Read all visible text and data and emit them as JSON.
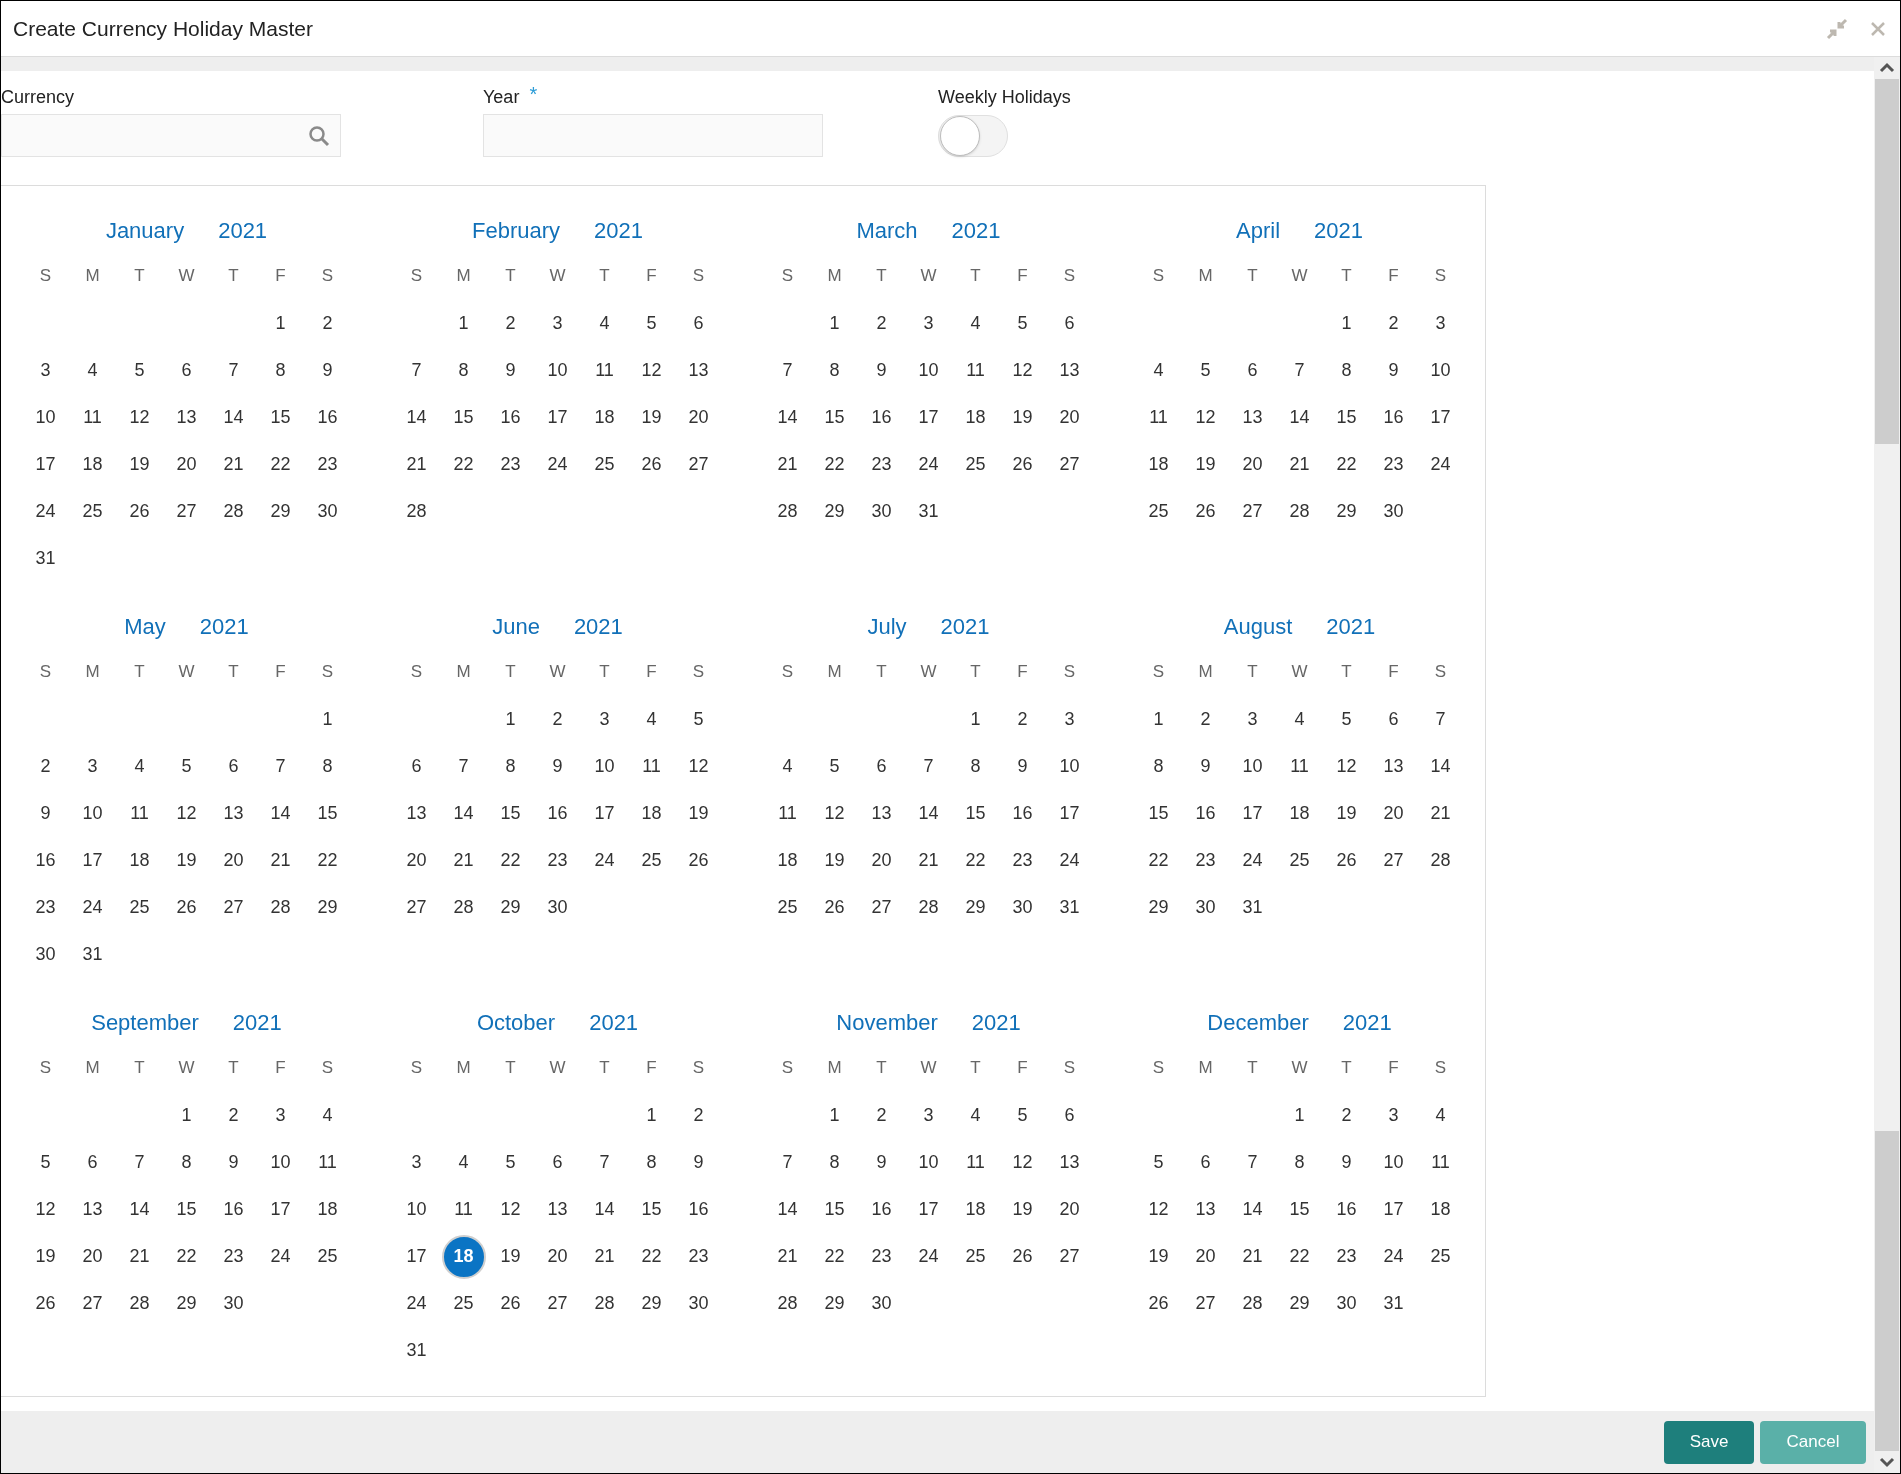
{
  "window": {
    "title": "Create Currency Holiday Master"
  },
  "form": {
    "currency": {
      "label": "Currency"
    },
    "year": {
      "label": "Year",
      "required_mark": "*"
    },
    "weekly_holidays": {
      "label": "Weekly Holidays",
      "on": false
    }
  },
  "months": [
    {
      "name": "January",
      "year": "2021",
      "weekdays": [
        "S",
        "M",
        "T",
        "W",
        "T",
        "F",
        "S"
      ],
      "weeks": [
        {
          "kind": "end",
          "days": [
            {
              "day": "1",
              "selected": false
            },
            {
              "day": "2",
              "selected": false
            }
          ]
        },
        {
          "kind": "start",
          "days": [
            {
              "day": "3",
              "selected": false
            },
            {
              "day": "4",
              "selected": false
            },
            {
              "day": "5",
              "selected": false
            },
            {
              "day": "6",
              "selected": false
            },
            {
              "day": "7",
              "selected": false
            },
            {
              "day": "8",
              "selected": false
            },
            {
              "day": "9",
              "selected": false
            }
          ]
        },
        {
          "kind": "start",
          "days": [
            {
              "day": "10",
              "selected": false
            },
            {
              "day": "11",
              "selected": false
            },
            {
              "day": "12",
              "selected": false
            },
            {
              "day": "13",
              "selected": false
            },
            {
              "day": "14",
              "selected": false
            },
            {
              "day": "15",
              "selected": false
            },
            {
              "day": "16",
              "selected": false
            }
          ]
        },
        {
          "kind": "start",
          "days": [
            {
              "day": "17",
              "selected": false
            },
            {
              "day": "18",
              "selected": false
            },
            {
              "day": "19",
              "selected": false
            },
            {
              "day": "20",
              "selected": false
            },
            {
              "day": "21",
              "selected": false
            },
            {
              "day": "22",
              "selected": false
            },
            {
              "day": "23",
              "selected": false
            }
          ]
        },
        {
          "kind": "start",
          "days": [
            {
              "day": "24",
              "selected": false
            },
            {
              "day": "25",
              "selected": false
            },
            {
              "day": "26",
              "selected": false
            },
            {
              "day": "27",
              "selected": false
            },
            {
              "day": "28",
              "selected": false
            },
            {
              "day": "29",
              "selected": false
            },
            {
              "day": "30",
              "selected": false
            }
          ]
        },
        {
          "kind": "start",
          "days": [
            {
              "day": "31",
              "selected": false
            }
          ]
        }
      ]
    },
    {
      "name": "February",
      "year": "2021",
      "weekdays": [
        "S",
        "M",
        "T",
        "W",
        "T",
        "F",
        "S"
      ],
      "weeks": [
        {
          "kind": "end",
          "days": [
            {
              "day": "1",
              "selected": false
            },
            {
              "day": "2",
              "selected": false
            },
            {
              "day": "3",
              "selected": false
            },
            {
              "day": "4",
              "selected": false
            },
            {
              "day": "5",
              "selected": false
            },
            {
              "day": "6",
              "selected": false
            }
          ]
        },
        {
          "kind": "start",
          "days": [
            {
              "day": "7",
              "selected": false
            },
            {
              "day": "8",
              "selected": false
            },
            {
              "day": "9",
              "selected": false
            },
            {
              "day": "10",
              "selected": false
            },
            {
              "day": "11",
              "selected": false
            },
            {
              "day": "12",
              "selected": false
            },
            {
              "day": "13",
              "selected": false
            }
          ]
        },
        {
          "kind": "start",
          "days": [
            {
              "day": "14",
              "selected": false
            },
            {
              "day": "15",
              "selected": false
            },
            {
              "day": "16",
              "selected": false
            },
            {
              "day": "17",
              "selected": false
            },
            {
              "day": "18",
              "selected": false
            },
            {
              "day": "19",
              "selected": false
            },
            {
              "day": "20",
              "selected": false
            }
          ]
        },
        {
          "kind": "start",
          "days": [
            {
              "day": "21",
              "selected": false
            },
            {
              "day": "22",
              "selected": false
            },
            {
              "day": "23",
              "selected": false
            },
            {
              "day": "24",
              "selected": false
            },
            {
              "day": "25",
              "selected": false
            },
            {
              "day": "26",
              "selected": false
            },
            {
              "day": "27",
              "selected": false
            }
          ]
        },
        {
          "kind": "start",
          "days": [
            {
              "day": "28",
              "selected": false
            }
          ]
        }
      ]
    },
    {
      "name": "March",
      "year": "2021",
      "weekdays": [
        "S",
        "M",
        "T",
        "W",
        "T",
        "F",
        "S"
      ],
      "weeks": [
        {
          "kind": "end",
          "days": [
            {
              "day": "1",
              "selected": false
            },
            {
              "day": "2",
              "selected": false
            },
            {
              "day": "3",
              "selected": false
            },
            {
              "day": "4",
              "selected": false
            },
            {
              "day": "5",
              "selected": false
            },
            {
              "day": "6",
              "selected": false
            }
          ]
        },
        {
          "kind": "start",
          "days": [
            {
              "day": "7",
              "selected": false
            },
            {
              "day": "8",
              "selected": false
            },
            {
              "day": "9",
              "selected": false
            },
            {
              "day": "10",
              "selected": false
            },
            {
              "day": "11",
              "selected": false
            },
            {
              "day": "12",
              "selected": false
            },
            {
              "day": "13",
              "selected": false
            }
          ]
        },
        {
          "kind": "start",
          "days": [
            {
              "day": "14",
              "selected": false
            },
            {
              "day": "15",
              "selected": false
            },
            {
              "day": "16",
              "selected": false
            },
            {
              "day": "17",
              "selected": false
            },
            {
              "day": "18",
              "selected": false
            },
            {
              "day": "19",
              "selected": false
            },
            {
              "day": "20",
              "selected": false
            }
          ]
        },
        {
          "kind": "start",
          "days": [
            {
              "day": "21",
              "selected": false
            },
            {
              "day": "22",
              "selected": false
            },
            {
              "day": "23",
              "selected": false
            },
            {
              "day": "24",
              "selected": false
            },
            {
              "day": "25",
              "selected": false
            },
            {
              "day": "26",
              "selected": false
            },
            {
              "day": "27",
              "selected": false
            }
          ]
        },
        {
          "kind": "start",
          "days": [
            {
              "day": "28",
              "selected": false
            },
            {
              "day": "29",
              "selected": false
            },
            {
              "day": "30",
              "selected": false
            },
            {
              "day": "31",
              "selected": false
            }
          ]
        }
      ]
    },
    {
      "name": "April",
      "year": "2021",
      "weekdays": [
        "S",
        "M",
        "T",
        "W",
        "T",
        "F",
        "S"
      ],
      "weeks": [
        {
          "kind": "end",
          "days": [
            {
              "day": "1",
              "selected": false
            },
            {
              "day": "2",
              "selected": false
            },
            {
              "day": "3",
              "selected": false
            }
          ]
        },
        {
          "kind": "start",
          "days": [
            {
              "day": "4",
              "selected": false
            },
            {
              "day": "5",
              "selected": false
            },
            {
              "day": "6",
              "selected": false
            },
            {
              "day": "7",
              "selected": false
            },
            {
              "day": "8",
              "selected": false
            },
            {
              "day": "9",
              "selected": false
            },
            {
              "day": "10",
              "selected": false
            }
          ]
        },
        {
          "kind": "start",
          "days": [
            {
              "day": "11",
              "selected": false
            },
            {
              "day": "12",
              "selected": false
            },
            {
              "day": "13",
              "selected": false
            },
            {
              "day": "14",
              "selected": false
            },
            {
              "day": "15",
              "selected": false
            },
            {
              "day": "16",
              "selected": false
            },
            {
              "day": "17",
              "selected": false
            }
          ]
        },
        {
          "kind": "start",
          "days": [
            {
              "day": "18",
              "selected": false
            },
            {
              "day": "19",
              "selected": false
            },
            {
              "day": "20",
              "selected": false
            },
            {
              "day": "21",
              "selected": false
            },
            {
              "day": "22",
              "selected": false
            },
            {
              "day": "23",
              "selected": false
            },
            {
              "day": "24",
              "selected": false
            }
          ]
        },
        {
          "kind": "start",
          "days": [
            {
              "day": "25",
              "selected": false
            },
            {
              "day": "26",
              "selected": false
            },
            {
              "day": "27",
              "selected": false
            },
            {
              "day": "28",
              "selected": false
            },
            {
              "day": "29",
              "selected": false
            },
            {
              "day": "30",
              "selected": false
            }
          ]
        }
      ]
    },
    {
      "name": "May",
      "year": "2021",
      "weekdays": [
        "S",
        "M",
        "T",
        "W",
        "T",
        "F",
        "S"
      ],
      "weeks": [
        {
          "kind": "end",
          "days": [
            {
              "day": "1",
              "selected": false
            }
          ]
        },
        {
          "kind": "start",
          "days": [
            {
              "day": "2",
              "selected": false
            },
            {
              "day": "3",
              "selected": false
            },
            {
              "day": "4",
              "selected": false
            },
            {
              "day": "5",
              "selected": false
            },
            {
              "day": "6",
              "selected": false
            },
            {
              "day": "7",
              "selected": false
            },
            {
              "day": "8",
              "selected": false
            }
          ]
        },
        {
          "kind": "start",
          "days": [
            {
              "day": "9",
              "selected": false
            },
            {
              "day": "10",
              "selected": false
            },
            {
              "day": "11",
              "selected": false
            },
            {
              "day": "12",
              "selected": false
            },
            {
              "day": "13",
              "selected": false
            },
            {
              "day": "14",
              "selected": false
            },
            {
              "day": "15",
              "selected": false
            }
          ]
        },
        {
          "kind": "start",
          "days": [
            {
              "day": "16",
              "selected": false
            },
            {
              "day": "17",
              "selected": false
            },
            {
              "day": "18",
              "selected": false
            },
            {
              "day": "19",
              "selected": false
            },
            {
              "day": "20",
              "selected": false
            },
            {
              "day": "21",
              "selected": false
            },
            {
              "day": "22",
              "selected": false
            }
          ]
        },
        {
          "kind": "start",
          "days": [
            {
              "day": "23",
              "selected": false
            },
            {
              "day": "24",
              "selected": false
            },
            {
              "day": "25",
              "selected": false
            },
            {
              "day": "26",
              "selected": false
            },
            {
              "day": "27",
              "selected": false
            },
            {
              "day": "28",
              "selected": false
            },
            {
              "day": "29",
              "selected": false
            }
          ]
        },
        {
          "kind": "start",
          "days": [
            {
              "day": "30",
              "selected": false
            },
            {
              "day": "31",
              "selected": false
            }
          ]
        }
      ]
    },
    {
      "name": "June",
      "year": "2021",
      "weekdays": [
        "S",
        "M",
        "T",
        "W",
        "T",
        "F",
        "S"
      ],
      "weeks": [
        {
          "kind": "end",
          "days": [
            {
              "day": "1",
              "selected": false
            },
            {
              "day": "2",
              "selected": false
            },
            {
              "day": "3",
              "selected": false
            },
            {
              "day": "4",
              "selected": false
            },
            {
              "day": "5",
              "selected": false
            }
          ]
        },
        {
          "kind": "start",
          "days": [
            {
              "day": "6",
              "selected": false
            },
            {
              "day": "7",
              "selected": false
            },
            {
              "day": "8",
              "selected": false
            },
            {
              "day": "9",
              "selected": false
            },
            {
              "day": "10",
              "selected": false
            },
            {
              "day": "11",
              "selected": false
            },
            {
              "day": "12",
              "selected": false
            }
          ]
        },
        {
          "kind": "start",
          "days": [
            {
              "day": "13",
              "selected": false
            },
            {
              "day": "14",
              "selected": false
            },
            {
              "day": "15",
              "selected": false
            },
            {
              "day": "16",
              "selected": false
            },
            {
              "day": "17",
              "selected": false
            },
            {
              "day": "18",
              "selected": false
            },
            {
              "day": "19",
              "selected": false
            }
          ]
        },
        {
          "kind": "start",
          "days": [
            {
              "day": "20",
              "selected": false
            },
            {
              "day": "21",
              "selected": false
            },
            {
              "day": "22",
              "selected": false
            },
            {
              "day": "23",
              "selected": false
            },
            {
              "day": "24",
              "selected": false
            },
            {
              "day": "25",
              "selected": false
            },
            {
              "day": "26",
              "selected": false
            }
          ]
        },
        {
          "kind": "start",
          "days": [
            {
              "day": "27",
              "selected": false
            },
            {
              "day": "28",
              "selected": false
            },
            {
              "day": "29",
              "selected": false
            },
            {
              "day": "30",
              "selected": false
            }
          ]
        }
      ]
    },
    {
      "name": "July",
      "year": "2021",
      "weekdays": [
        "S",
        "M",
        "T",
        "W",
        "T",
        "F",
        "S"
      ],
      "weeks": [
        {
          "kind": "end",
          "days": [
            {
              "day": "1",
              "selected": false
            },
            {
              "day": "2",
              "selected": false
            },
            {
              "day": "3",
              "selected": false
            }
          ]
        },
        {
          "kind": "start",
          "days": [
            {
              "day": "4",
              "selected": false
            },
            {
              "day": "5",
              "selected": false
            },
            {
              "day": "6",
              "selected": false
            },
            {
              "day": "7",
              "selected": false
            },
            {
              "day": "8",
              "selected": false
            },
            {
              "day": "9",
              "selected": false
            },
            {
              "day": "10",
              "selected": false
            }
          ]
        },
        {
          "kind": "start",
          "days": [
            {
              "day": "11",
              "selected": false
            },
            {
              "day": "12",
              "selected": false
            },
            {
              "day": "13",
              "selected": false
            },
            {
              "day": "14",
              "selected": false
            },
            {
              "day": "15",
              "selected": false
            },
            {
              "day": "16",
              "selected": false
            },
            {
              "day": "17",
              "selected": false
            }
          ]
        },
        {
          "kind": "start",
          "days": [
            {
              "day": "18",
              "selected": false
            },
            {
              "day": "19",
              "selected": false
            },
            {
              "day": "20",
              "selected": false
            },
            {
              "day": "21",
              "selected": false
            },
            {
              "day": "22",
              "selected": false
            },
            {
              "day": "23",
              "selected": false
            },
            {
              "day": "24",
              "selected": false
            }
          ]
        },
        {
          "kind": "start",
          "days": [
            {
              "day": "25",
              "selected": false
            },
            {
              "day": "26",
              "selected": false
            },
            {
              "day": "27",
              "selected": false
            },
            {
              "day": "28",
              "selected": false
            },
            {
              "day": "29",
              "selected": false
            },
            {
              "day": "30",
              "selected": false
            },
            {
              "day": "31",
              "selected": false
            }
          ]
        }
      ]
    },
    {
      "name": "August",
      "year": "2021",
      "weekdays": [
        "S",
        "M",
        "T",
        "W",
        "T",
        "F",
        "S"
      ],
      "weeks": [
        {
          "kind": "start",
          "days": [
            {
              "day": "1",
              "selected": false
            },
            {
              "day": "2",
              "selected": false
            },
            {
              "day": "3",
              "selected": false
            },
            {
              "day": "4",
              "selected": false
            },
            {
              "day": "5",
              "selected": false
            },
            {
              "day": "6",
              "selected": false
            },
            {
              "day": "7",
              "selected": false
            }
          ]
        },
        {
          "kind": "start",
          "days": [
            {
              "day": "8",
              "selected": false
            },
            {
              "day": "9",
              "selected": false
            },
            {
              "day": "10",
              "selected": false
            },
            {
              "day": "11",
              "selected": false
            },
            {
              "day": "12",
              "selected": false
            },
            {
              "day": "13",
              "selected": false
            },
            {
              "day": "14",
              "selected": false
            }
          ]
        },
        {
          "kind": "start",
          "days": [
            {
              "day": "15",
              "selected": false
            },
            {
              "day": "16",
              "selected": false
            },
            {
              "day": "17",
              "selected": false
            },
            {
              "day": "18",
              "selected": false
            },
            {
              "day": "19",
              "selected": false
            },
            {
              "day": "20",
              "selected": false
            },
            {
              "day": "21",
              "selected": false
            }
          ]
        },
        {
          "kind": "start",
          "days": [
            {
              "day": "22",
              "selected": false
            },
            {
              "day": "23",
              "selected": false
            },
            {
              "day": "24",
              "selected": false
            },
            {
              "day": "25",
              "selected": false
            },
            {
              "day": "26",
              "selected": false
            },
            {
              "day": "27",
              "selected": false
            },
            {
              "day": "28",
              "selected": false
            }
          ]
        },
        {
          "kind": "start",
          "days": [
            {
              "day": "29",
              "selected": false
            },
            {
              "day": "30",
              "selected": false
            },
            {
              "day": "31",
              "selected": false
            }
          ]
        }
      ]
    },
    {
      "name": "September",
      "year": "2021",
      "weekdays": [
        "S",
        "M",
        "T",
        "W",
        "T",
        "F",
        "S"
      ],
      "weeks": [
        {
          "kind": "end",
          "days": [
            {
              "day": "1",
              "selected": false
            },
            {
              "day": "2",
              "selected": false
            },
            {
              "day": "3",
              "selected": false
            },
            {
              "day": "4",
              "selected": false
            }
          ]
        },
        {
          "kind": "start",
          "days": [
            {
              "day": "5",
              "selected": false
            },
            {
              "day": "6",
              "selected": false
            },
            {
              "day": "7",
              "selected": false
            },
            {
              "day": "8",
              "selected": false
            },
            {
              "day": "9",
              "selected": false
            },
            {
              "day": "10",
              "selected": false
            },
            {
              "day": "11",
              "selected": false
            }
          ]
        },
        {
          "kind": "start",
          "days": [
            {
              "day": "12",
              "selected": false
            },
            {
              "day": "13",
              "selected": false
            },
            {
              "day": "14",
              "selected": false
            },
            {
              "day": "15",
              "selected": false
            },
            {
              "day": "16",
              "selected": false
            },
            {
              "day": "17",
              "selected": false
            },
            {
              "day": "18",
              "selected": false
            }
          ]
        },
        {
          "kind": "start",
          "days": [
            {
              "day": "19",
              "selected": false
            },
            {
              "day": "20",
              "selected": false
            },
            {
              "day": "21",
              "selected": false
            },
            {
              "day": "22",
              "selected": false
            },
            {
              "day": "23",
              "selected": false
            },
            {
              "day": "24",
              "selected": false
            },
            {
              "day": "25",
              "selected": false
            }
          ]
        },
        {
          "kind": "start",
          "days": [
            {
              "day": "26",
              "selected": false
            },
            {
              "day": "27",
              "selected": false
            },
            {
              "day": "28",
              "selected": false
            },
            {
              "day": "29",
              "selected": false
            },
            {
              "day": "30",
              "selected": false
            }
          ]
        }
      ]
    },
    {
      "name": "October",
      "year": "2021",
      "weekdays": [
        "S",
        "M",
        "T",
        "W",
        "T",
        "F",
        "S"
      ],
      "weeks": [
        {
          "kind": "end",
          "days": [
            {
              "day": "1",
              "selected": false
            },
            {
              "day": "2",
              "selected": false
            }
          ]
        },
        {
          "kind": "start",
          "days": [
            {
              "day": "3",
              "selected": false
            },
            {
              "day": "4",
              "selected": false
            },
            {
              "day": "5",
              "selected": false
            },
            {
              "day": "6",
              "selected": false
            },
            {
              "day": "7",
              "selected": false
            },
            {
              "day": "8",
              "selected": false
            },
            {
              "day": "9",
              "selected": false
            }
          ]
        },
        {
          "kind": "start",
          "days": [
            {
              "day": "10",
              "selected": false
            },
            {
              "day": "11",
              "selected": false
            },
            {
              "day": "12",
              "selected": false
            },
            {
              "day": "13",
              "selected": false
            },
            {
              "day": "14",
              "selected": false
            },
            {
              "day": "15",
              "selected": false
            },
            {
              "day": "16",
              "selected": false
            }
          ]
        },
        {
          "kind": "start",
          "days": [
            {
              "day": "17",
              "selected": false
            },
            {
              "day": "18",
              "selected": true
            },
            {
              "day": "19",
              "selected": false
            },
            {
              "day": "20",
              "selected": false
            },
            {
              "day": "21",
              "selected": false
            },
            {
              "day": "22",
              "selected": false
            },
            {
              "day": "23",
              "selected": false
            }
          ]
        },
        {
          "kind": "start",
          "days": [
            {
              "day": "24",
              "selected": false
            },
            {
              "day": "25",
              "selected": false
            },
            {
              "day": "26",
              "selected": false
            },
            {
              "day": "27",
              "selected": false
            },
            {
              "day": "28",
              "selected": false
            },
            {
              "day": "29",
              "selected": false
            },
            {
              "day": "30",
              "selected": false
            }
          ]
        },
        {
          "kind": "start",
          "days": [
            {
              "day": "31",
              "selected": false
            }
          ]
        }
      ]
    },
    {
      "name": "November",
      "year": "2021",
      "weekdays": [
        "S",
        "M",
        "T",
        "W",
        "T",
        "F",
        "S"
      ],
      "weeks": [
        {
          "kind": "end",
          "days": [
            {
              "day": "1",
              "selected": false
            },
            {
              "day": "2",
              "selected": false
            },
            {
              "day": "3",
              "selected": false
            },
            {
              "day": "4",
              "selected": false
            },
            {
              "day": "5",
              "selected": false
            },
            {
              "day": "6",
              "selected": false
            }
          ]
        },
        {
          "kind": "start",
          "days": [
            {
              "day": "7",
              "selected": false
            },
            {
              "day": "8",
              "selected": false
            },
            {
              "day": "9",
              "selected": false
            },
            {
              "day": "10",
              "selected": false
            },
            {
              "day": "11",
              "selected": false
            },
            {
              "day": "12",
              "selected": false
            },
            {
              "day": "13",
              "selected": false
            }
          ]
        },
        {
          "kind": "start",
          "days": [
            {
              "day": "14",
              "selected": false
            },
            {
              "day": "15",
              "selected": false
            },
            {
              "day": "16",
              "selected": false
            },
            {
              "day": "17",
              "selected": false
            },
            {
              "day": "18",
              "selected": false
            },
            {
              "day": "19",
              "selected": false
            },
            {
              "day": "20",
              "selected": false
            }
          ]
        },
        {
          "kind": "start",
          "days": [
            {
              "day": "21",
              "selected": false
            },
            {
              "day": "22",
              "selected": false
            },
            {
              "day": "23",
              "selected": false
            },
            {
              "day": "24",
              "selected": false
            },
            {
              "day": "25",
              "selected": false
            },
            {
              "day": "26",
              "selected": false
            },
            {
              "day": "27",
              "selected": false
            }
          ]
        },
        {
          "kind": "start",
          "days": [
            {
              "day": "28",
              "selected": false
            },
            {
              "day": "29",
              "selected": false
            },
            {
              "day": "30",
              "selected": false
            }
          ]
        }
      ]
    },
    {
      "name": "December",
      "year": "2021",
      "weekdays": [
        "S",
        "M",
        "T",
        "W",
        "T",
        "F",
        "S"
      ],
      "weeks": [
        {
          "kind": "end",
          "days": [
            {
              "day": "1",
              "selected": false
            },
            {
              "day": "2",
              "selected": false
            },
            {
              "day": "3",
              "selected": false
            },
            {
              "day": "4",
              "selected": false
            }
          ]
        },
        {
          "kind": "start",
          "days": [
            {
              "day": "5",
              "selected": false
            },
            {
              "day": "6",
              "selected": false
            },
            {
              "day": "7",
              "selected": false
            },
            {
              "day": "8",
              "selected": false
            },
            {
              "day": "9",
              "selected": false
            },
            {
              "day": "10",
              "selected": false
            },
            {
              "day": "11",
              "selected": false
            }
          ]
        },
        {
          "kind": "start",
          "days": [
            {
              "day": "12",
              "selected": false
            },
            {
              "day": "13",
              "selected": false
            },
            {
              "day": "14",
              "selected": false
            },
            {
              "day": "15",
              "selected": false
            },
            {
              "day": "16",
              "selected": false
            },
            {
              "day": "17",
              "selected": false
            },
            {
              "day": "18",
              "selected": false
            }
          ]
        },
        {
          "kind": "start",
          "days": [
            {
              "day": "19",
              "selected": false
            },
            {
              "day": "20",
              "selected": false
            },
            {
              "day": "21",
              "selected": false
            },
            {
              "day": "22",
              "selected": false
            },
            {
              "day": "23",
              "selected": false
            },
            {
              "day": "24",
              "selected": false
            },
            {
              "day": "25",
              "selected": false
            }
          ]
        },
        {
          "kind": "start",
          "days": [
            {
              "day": "26",
              "selected": false
            },
            {
              "day": "27",
              "selected": false
            },
            {
              "day": "28",
              "selected": false
            },
            {
              "day": "29",
              "selected": false
            },
            {
              "day": "30",
              "selected": false
            },
            {
              "day": "31",
              "selected": false
            }
          ]
        }
      ]
    }
  ],
  "buttons": [
    {
      "label": "Save",
      "kind": "primary"
    },
    {
      "label": "Cancel",
      "kind": "secondary"
    }
  ]
}
